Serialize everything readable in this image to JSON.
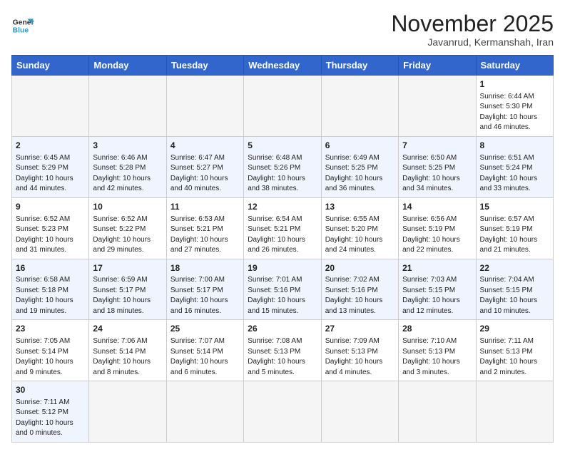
{
  "header": {
    "logo_general": "General",
    "logo_blue": "Blue",
    "month_year": "November 2025",
    "location": "Javanrud, Kermanshah, Iran"
  },
  "weekdays": [
    "Sunday",
    "Monday",
    "Tuesday",
    "Wednesday",
    "Thursday",
    "Friday",
    "Saturday"
  ],
  "weeks": [
    [
      {
        "day": "",
        "info": ""
      },
      {
        "day": "",
        "info": ""
      },
      {
        "day": "",
        "info": ""
      },
      {
        "day": "",
        "info": ""
      },
      {
        "day": "",
        "info": ""
      },
      {
        "day": "",
        "info": ""
      },
      {
        "day": "1",
        "info": "Sunrise: 6:44 AM\nSunset: 5:30 PM\nDaylight: 10 hours\nand 46 minutes."
      }
    ],
    [
      {
        "day": "2",
        "info": "Sunrise: 6:45 AM\nSunset: 5:29 PM\nDaylight: 10 hours\nand 44 minutes."
      },
      {
        "day": "3",
        "info": "Sunrise: 6:46 AM\nSunset: 5:28 PM\nDaylight: 10 hours\nand 42 minutes."
      },
      {
        "day": "4",
        "info": "Sunrise: 6:47 AM\nSunset: 5:27 PM\nDaylight: 10 hours\nand 40 minutes."
      },
      {
        "day": "5",
        "info": "Sunrise: 6:48 AM\nSunset: 5:26 PM\nDaylight: 10 hours\nand 38 minutes."
      },
      {
        "day": "6",
        "info": "Sunrise: 6:49 AM\nSunset: 5:25 PM\nDaylight: 10 hours\nand 36 minutes."
      },
      {
        "day": "7",
        "info": "Sunrise: 6:50 AM\nSunset: 5:25 PM\nDaylight: 10 hours\nand 34 minutes."
      },
      {
        "day": "8",
        "info": "Sunrise: 6:51 AM\nSunset: 5:24 PM\nDaylight: 10 hours\nand 33 minutes."
      }
    ],
    [
      {
        "day": "9",
        "info": "Sunrise: 6:52 AM\nSunset: 5:23 PM\nDaylight: 10 hours\nand 31 minutes."
      },
      {
        "day": "10",
        "info": "Sunrise: 6:52 AM\nSunset: 5:22 PM\nDaylight: 10 hours\nand 29 minutes."
      },
      {
        "day": "11",
        "info": "Sunrise: 6:53 AM\nSunset: 5:21 PM\nDaylight: 10 hours\nand 27 minutes."
      },
      {
        "day": "12",
        "info": "Sunrise: 6:54 AM\nSunset: 5:21 PM\nDaylight: 10 hours\nand 26 minutes."
      },
      {
        "day": "13",
        "info": "Sunrise: 6:55 AM\nSunset: 5:20 PM\nDaylight: 10 hours\nand 24 minutes."
      },
      {
        "day": "14",
        "info": "Sunrise: 6:56 AM\nSunset: 5:19 PM\nDaylight: 10 hours\nand 22 minutes."
      },
      {
        "day": "15",
        "info": "Sunrise: 6:57 AM\nSunset: 5:19 PM\nDaylight: 10 hours\nand 21 minutes."
      }
    ],
    [
      {
        "day": "16",
        "info": "Sunrise: 6:58 AM\nSunset: 5:18 PM\nDaylight: 10 hours\nand 19 minutes."
      },
      {
        "day": "17",
        "info": "Sunrise: 6:59 AM\nSunset: 5:17 PM\nDaylight: 10 hours\nand 18 minutes."
      },
      {
        "day": "18",
        "info": "Sunrise: 7:00 AM\nSunset: 5:17 PM\nDaylight: 10 hours\nand 16 minutes."
      },
      {
        "day": "19",
        "info": "Sunrise: 7:01 AM\nSunset: 5:16 PM\nDaylight: 10 hours\nand 15 minutes."
      },
      {
        "day": "20",
        "info": "Sunrise: 7:02 AM\nSunset: 5:16 PM\nDaylight: 10 hours\nand 13 minutes."
      },
      {
        "day": "21",
        "info": "Sunrise: 7:03 AM\nSunset: 5:15 PM\nDaylight: 10 hours\nand 12 minutes."
      },
      {
        "day": "22",
        "info": "Sunrise: 7:04 AM\nSunset: 5:15 PM\nDaylight: 10 hours\nand 10 minutes."
      }
    ],
    [
      {
        "day": "23",
        "info": "Sunrise: 7:05 AM\nSunset: 5:14 PM\nDaylight: 10 hours\nand 9 minutes."
      },
      {
        "day": "24",
        "info": "Sunrise: 7:06 AM\nSunset: 5:14 PM\nDaylight: 10 hours\nand 8 minutes."
      },
      {
        "day": "25",
        "info": "Sunrise: 7:07 AM\nSunset: 5:14 PM\nDaylight: 10 hours\nand 6 minutes."
      },
      {
        "day": "26",
        "info": "Sunrise: 7:08 AM\nSunset: 5:13 PM\nDaylight: 10 hours\nand 5 minutes."
      },
      {
        "day": "27",
        "info": "Sunrise: 7:09 AM\nSunset: 5:13 PM\nDaylight: 10 hours\nand 4 minutes."
      },
      {
        "day": "28",
        "info": "Sunrise: 7:10 AM\nSunset: 5:13 PM\nDaylight: 10 hours\nand 3 minutes."
      },
      {
        "day": "29",
        "info": "Sunrise: 7:11 AM\nSunset: 5:13 PM\nDaylight: 10 hours\nand 2 minutes."
      }
    ],
    [
      {
        "day": "30",
        "info": "Sunrise: 7:11 AM\nSunset: 5:12 PM\nDaylight: 10 hours\nand 0 minutes."
      },
      {
        "day": "",
        "info": ""
      },
      {
        "day": "",
        "info": ""
      },
      {
        "day": "",
        "info": ""
      },
      {
        "day": "",
        "info": ""
      },
      {
        "day": "",
        "info": ""
      },
      {
        "day": "",
        "info": ""
      }
    ]
  ]
}
